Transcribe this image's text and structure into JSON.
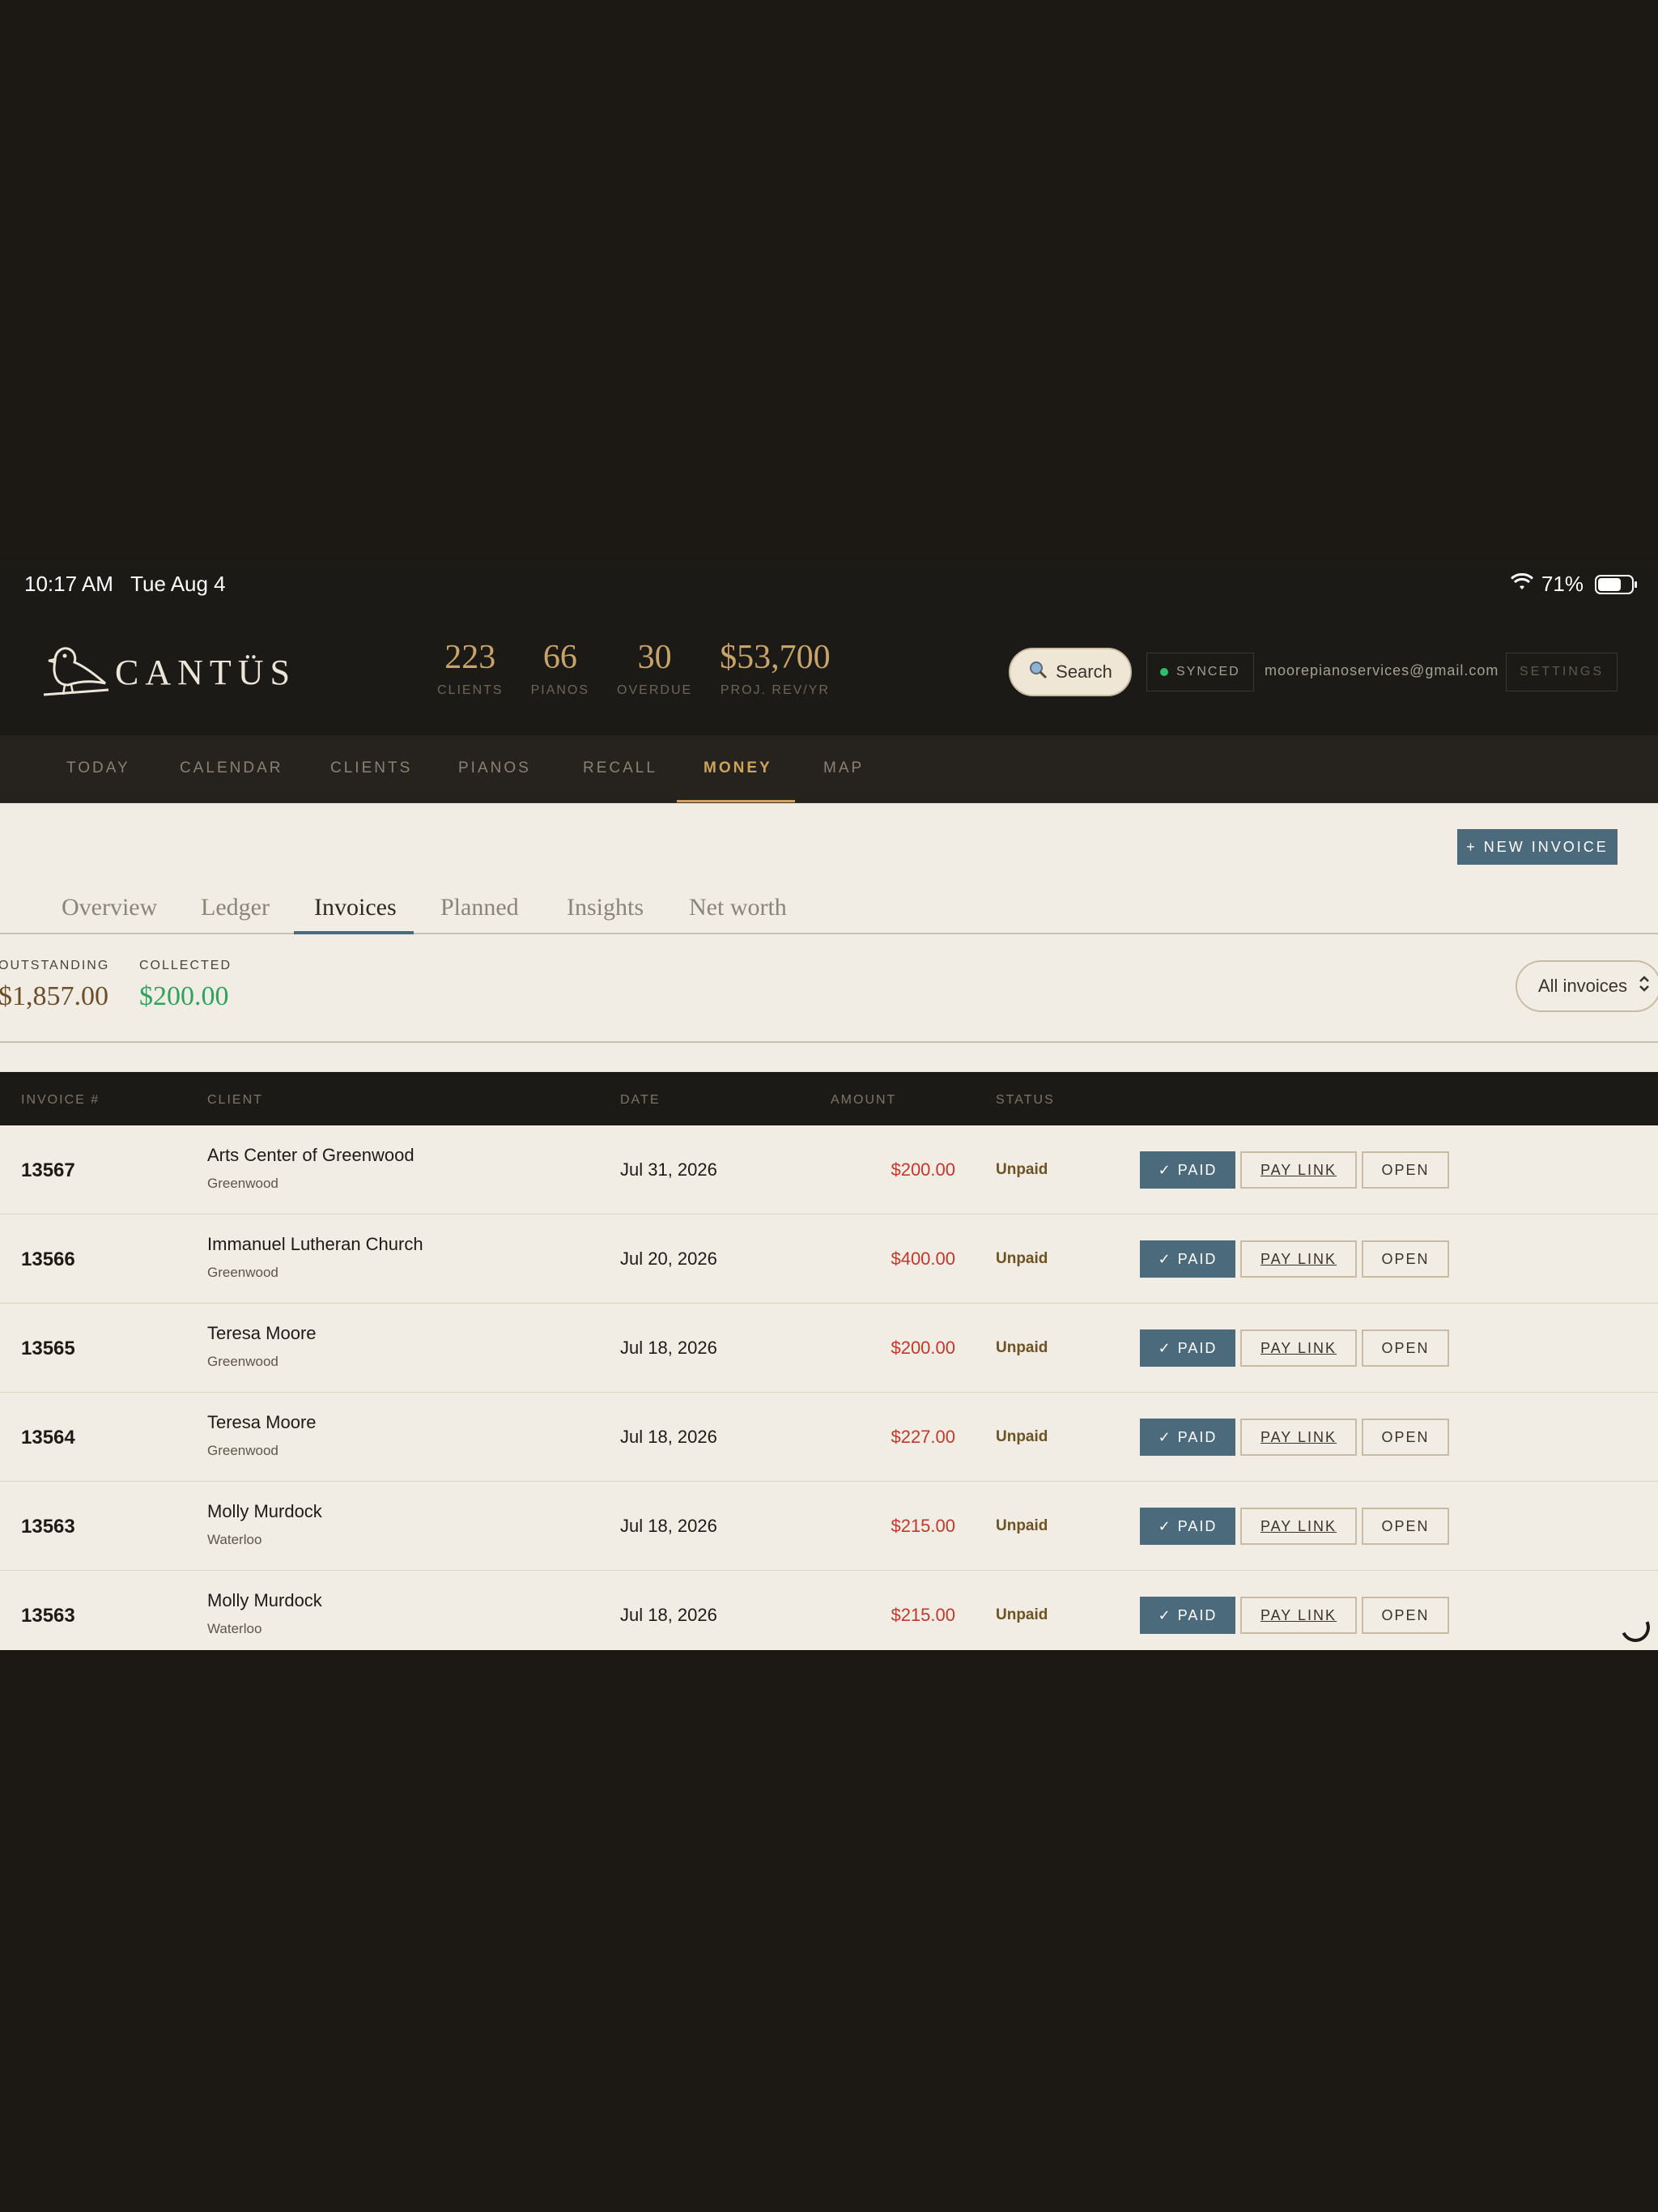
{
  "status_bar": {
    "time": "10:17 AM",
    "date": "Tue Aug 4",
    "battery": "71%"
  },
  "header": {
    "logo": "CANTÜS",
    "stats": [
      {
        "value": "223",
        "label": "CLIENTS"
      },
      {
        "value": "66",
        "label": "PIANOS"
      },
      {
        "value": "30",
        "label": "OVERDUE"
      },
      {
        "value": "$53,700",
        "label": "PROJ. REV/YR"
      }
    ],
    "search_label": "Search",
    "sync_label": "SYNCED",
    "email": "moorepianoservices@gmail.com",
    "settings_label": "SETTINGS"
  },
  "nav": {
    "items": [
      "TODAY",
      "CALENDAR",
      "CLIENTS",
      "PIANOS",
      "RECALL",
      "MONEY",
      "MAP"
    ],
    "active": "MONEY"
  },
  "money": {
    "new_invoice_label": "+ NEW INVOICE",
    "subtabs": [
      "Overview",
      "Ledger",
      "Invoices",
      "Planned",
      "Insights",
      "Net worth"
    ],
    "active_subtab": "Invoices",
    "summary": {
      "outstanding_label": "OUTSTANDING",
      "outstanding_value": "$1,857.00",
      "collected_label": "COLLECTED",
      "collected_value": "$200.00"
    },
    "filter": {
      "selected": "All invoices"
    },
    "table": {
      "headers": [
        "INVOICE #",
        "CLIENT",
        "DATE",
        "AMOUNT",
        "STATUS"
      ],
      "actions": {
        "paid": "✓ PAID",
        "pay_link": "PAY LINK",
        "open": "OPEN"
      },
      "rows": [
        {
          "number": "13567",
          "client": "Arts Center of Greenwood",
          "city": "Greenwood",
          "date": "Jul 31, 2026",
          "amount": "$200.00",
          "status": "Unpaid"
        },
        {
          "number": "13566",
          "client": "Immanuel Lutheran Church",
          "city": "Greenwood",
          "date": "Jul 20, 2026",
          "amount": "$400.00",
          "status": "Unpaid"
        },
        {
          "number": "13565",
          "client": "Teresa Moore",
          "city": "Greenwood",
          "date": "Jul 18, 2026",
          "amount": "$200.00",
          "status": "Unpaid"
        },
        {
          "number": "13564",
          "client": "Teresa Moore",
          "city": "Greenwood",
          "date": "Jul 18, 2026",
          "amount": "$227.00",
          "status": "Unpaid"
        },
        {
          "number": "13563",
          "client": "Molly Murdock",
          "city": "Waterloo",
          "date": "Jul 18, 2026",
          "amount": "$215.00",
          "status": "Unpaid"
        },
        {
          "number": "13563",
          "client": "Molly Murdock",
          "city": "Waterloo",
          "date": "Jul 18, 2026",
          "amount": "$215.00",
          "status": "Unpaid"
        }
      ]
    }
  },
  "colors": {
    "accent_gold": "#c8a46a",
    "nav_active": "#d0a35c",
    "primary_blue": "#4b6b7c",
    "amount_red": "#c0392b",
    "collected_green": "#2ea35a",
    "synced_green": "#2dbe6c"
  }
}
